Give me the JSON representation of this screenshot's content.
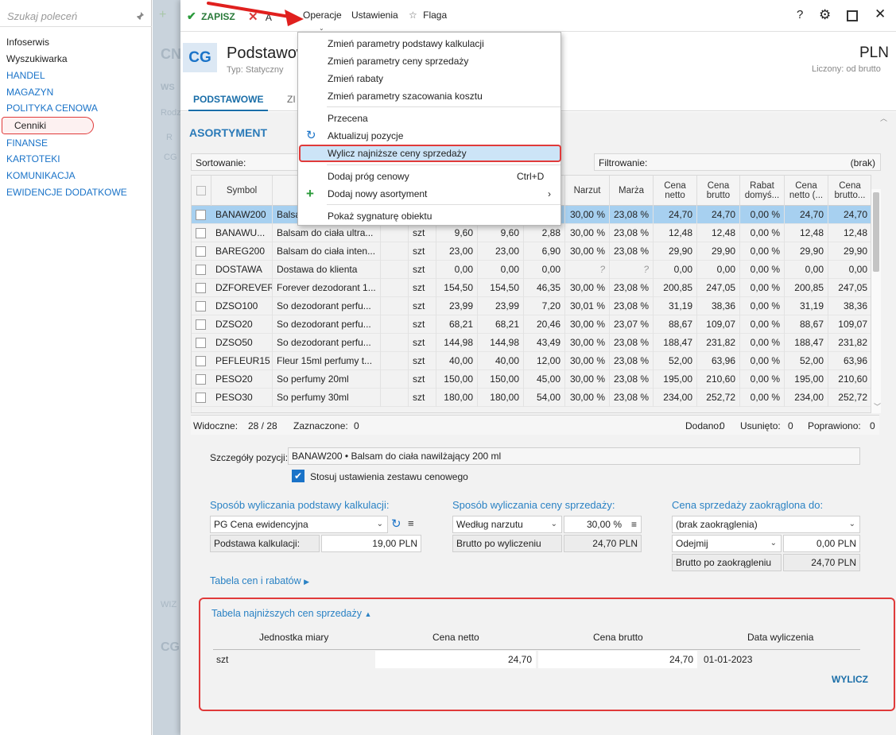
{
  "nav": {
    "search_placeholder": "Szukaj poleceń",
    "items": [
      {
        "label": "Infoserwis",
        "blue": false
      },
      {
        "label": "Wyszukiwarka",
        "blue": false
      },
      {
        "label": "HANDEL",
        "blue": true
      },
      {
        "label": "MAGAZYN",
        "blue": true
      },
      {
        "label": "POLITYKA CENOWA",
        "blue": true
      },
      {
        "label": "Cenniki",
        "blue": false
      },
      {
        "label": "FINANSE",
        "blue": true
      },
      {
        "label": "KARTOTEKI",
        "blue": true
      },
      {
        "label": "KOMUNIKACJA",
        "blue": true
      },
      {
        "label": "EWIDENCJE DODATKOWE",
        "blue": true
      }
    ]
  },
  "background": {
    "t1": "CN",
    "t2": "WS",
    "t3": "Rodz",
    "t4": "R",
    "t5": "CG",
    "t6": "WIZ",
    "t7": "CG"
  },
  "toolbar": {
    "save": "ZAPISZ",
    "cancel": "A",
    "operations": "Operacje",
    "settings": "Ustawienia",
    "flag": "Flaga"
  },
  "header": {
    "badge": "CG",
    "title": "Podstawow",
    "type": "Typ: Statyczny",
    "currency": "PLN",
    "calc": "Liczony: od brutto"
  },
  "tabs": {
    "active": "PODSTAWOWE",
    "other": "ZI"
  },
  "section": "ASORTYMENT",
  "sort_label": "Sortowanie:",
  "filter_label": "Filtrowanie:",
  "filter_value": "(brak)",
  "menu": {
    "items": [
      "Zmień parametry podstawy kalkulacji",
      "Zmień parametry ceny sprzedaży",
      "Zmień rabaty",
      "Zmień parametry szacowania kosztu",
      "Przecena",
      "Aktualizuj pozycje",
      "Wylicz najniższe ceny sprzedaży",
      "Dodaj próg cenowy",
      "Dodaj nowy asortyment",
      "Pokaż sygnaturę obiektu"
    ],
    "shortcut": "Ctrl+D"
  },
  "table": {
    "headers": [
      "Symbol",
      "",
      "",
      "",
      "",
      "",
      "Narzut",
      "Marża",
      "Cena netto",
      "Cena brutto",
      "Rabat domyś...",
      "Cena netto (...",
      "Cena brutto..."
    ],
    "rows": [
      [
        "BANAW200",
        "Balsa",
        "",
        "",
        "",
        "",
        "30,00 %",
        "23,08 %",
        "24,70",
        "24,70",
        "0,00 %",
        "24,70",
        "24,70"
      ],
      [
        "BANAWU...",
        "Balsam do ciała ultra...",
        "",
        "szt",
        "9,60",
        "9,60",
        "2,88",
        "30,00 %",
        "23,08 %",
        "12,48",
        "12,48",
        "0,00 %",
        "12,48",
        "12,48"
      ],
      [
        "BAREG200",
        "Balsam do ciała inten...",
        "",
        "szt",
        "23,00",
        "23,00",
        "6,90",
        "30,00 %",
        "23,08 %",
        "29,90",
        "29,90",
        "0,00 %",
        "29,90",
        "29,90"
      ],
      [
        "DOSTAWA",
        "Dostawa do klienta",
        "",
        "szt",
        "0,00",
        "0,00",
        "0,00",
        "?",
        "?",
        "0,00",
        "0,00",
        "0,00 %",
        "0,00",
        "0,00"
      ],
      [
        "DZFOREVER",
        "Forever dezodorant 1...",
        "",
        "szt",
        "154,50",
        "154,50",
        "46,35",
        "30,00 %",
        "23,08 %",
        "200,85",
        "247,05",
        "0,00 %",
        "200,85",
        "247,05"
      ],
      [
        "DZSO100",
        "So dezodorant perfu...",
        "",
        "szt",
        "23,99",
        "23,99",
        "7,20",
        "30,01 %",
        "23,08 %",
        "31,19",
        "38,36",
        "0,00 %",
        "31,19",
        "38,36"
      ],
      [
        "DZSO20",
        "So dezodorant perfu...",
        "",
        "szt",
        "68,21",
        "68,21",
        "20,46",
        "30,00 %",
        "23,07 %",
        "88,67",
        "109,07",
        "0,00 %",
        "88,67",
        "109,07"
      ],
      [
        "DZSO50",
        "So dezodorant perfu...",
        "",
        "szt",
        "144,98",
        "144,98",
        "43,49",
        "30,00 %",
        "23,08 %",
        "188,47",
        "231,82",
        "0,00 %",
        "188,47",
        "231,82"
      ],
      [
        "PEFLEUR15",
        "Fleur 15ml perfumy t...",
        "",
        "szt",
        "40,00",
        "40,00",
        "12,00",
        "30,00 %",
        "23,08 %",
        "52,00",
        "63,96",
        "0,00 %",
        "52,00",
        "63,96"
      ],
      [
        "PESO20",
        "So perfumy 20ml",
        "",
        "szt",
        "150,00",
        "150,00",
        "45,00",
        "30,00 %",
        "23,08 %",
        "195,00",
        "210,60",
        "0,00 %",
        "195,00",
        "210,60"
      ],
      [
        "PESO30",
        "So perfumy 30ml",
        "",
        "szt",
        "180,00",
        "180,00",
        "54,00",
        "30,00 %",
        "23,08 %",
        "234,00",
        "252,72",
        "0,00 %",
        "234,00",
        "252,72"
      ]
    ]
  },
  "stats": {
    "visible_label": "Widoczne:",
    "visible_value": "28 /  28",
    "selected_label": "Zaznaczone:",
    "selected_value": "0",
    "added_label": "Dodano:",
    "added_value": "0",
    "removed_label": "Usunięto:",
    "removed_value": "0",
    "fixed_label": "Poprawiono:",
    "fixed_value": "0"
  },
  "details": {
    "item_label": "Szczegóły pozycji:",
    "item_value": "BANAW200  •  Balsam do ciała nawilżający 200 ml",
    "apply_settings": "Stosuj ustawienia zestawu cenowego",
    "base_heading": "Sposób wyliczania podstawy kalkulacji:",
    "base_select": "PG  Cena ewidencyjna",
    "base_label": "Podstawa kalkulacji:",
    "base_value": "19,00 PLN",
    "sale_heading": "Sposób wyliczania ceny sprzedaży:",
    "sale_select": "Według narzutu",
    "sale_pct": "30,00 %",
    "sale_label": "Brutto po wyliczeniu",
    "sale_value": "24,70 PLN",
    "round_heading": "Cena sprzedaży zaokrąglona do:",
    "round_select": "(brak zaokrąglenia)",
    "round_op": "Odejmij",
    "round_op_value": "0,00 PLN",
    "round_label": "Brutto po zaokrągleniu",
    "round_value": "24,70 PLN",
    "prices_link": "Tabela cen i rabatów",
    "lowest_link": "Tabela najniższych cen sprzedaży",
    "lowest_headers": [
      "Jednostka miary",
      "Cena netto",
      "Cena brutto",
      "Data wyliczenia"
    ],
    "lowest_row": [
      "szt",
      "24,70",
      "24,70",
      "01-01-2023"
    ],
    "calc_button": "WYLICZ"
  }
}
